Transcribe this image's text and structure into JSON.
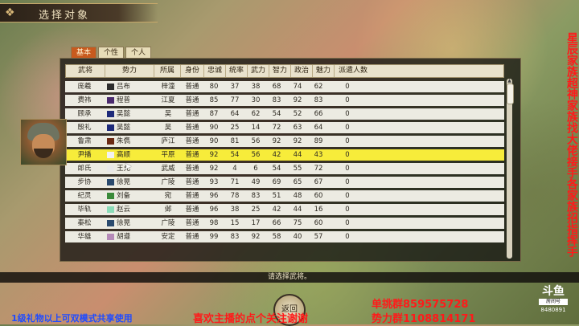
{
  "header": {
    "title": "选择对象"
  },
  "tabs": [
    "基本",
    "个性",
    "个人"
  ],
  "table": {
    "headers": [
      "武将",
      "势力",
      "所属",
      "身份",
      "忠诚",
      "统率",
      "武力",
      "智力",
      "政治",
      "魅力",
      "派遣人数"
    ],
    "rows": [
      {
        "name": "庞羲",
        "force": "吕布",
        "color": "#2c2c2c",
        "belong": "梓潼",
        "status": "普通",
        "loyalty": "80",
        "lead": "37",
        "war": "38",
        "intel": "68",
        "pol": "74",
        "chr": "62",
        "dispatch": "0",
        "selected": false
      },
      {
        "name": "费祎",
        "force": "程普",
        "color": "#4a2a6e",
        "belong": "江夏",
        "status": "普通",
        "loyalty": "85",
        "lead": "77",
        "war": "30",
        "intel": "83",
        "pol": "92",
        "chr": "83",
        "dispatch": "0",
        "selected": false
      },
      {
        "name": "顾承",
        "force": "吴懿",
        "color": "#1d2a7a",
        "belong": "吴",
        "status": "普通",
        "loyalty": "87",
        "lead": "64",
        "war": "62",
        "intel": "54",
        "pol": "52",
        "chr": "66",
        "dispatch": "0",
        "selected": false
      },
      {
        "name": "殷礼",
        "force": "吴懿",
        "color": "#1d2a7a",
        "belong": "吴",
        "status": "普通",
        "loyalty": "90",
        "lead": "25",
        "war": "14",
        "intel": "72",
        "pol": "63",
        "chr": "64",
        "dispatch": "0",
        "selected": false
      },
      {
        "name": "鲁肃",
        "force": "朱儁",
        "color": "#6b2a14",
        "belong": "庐江",
        "status": "普通",
        "loyalty": "90",
        "lead": "81",
        "war": "56",
        "intel": "92",
        "pol": "92",
        "chr": "89",
        "dispatch": "0",
        "selected": false
      },
      {
        "name": "尹播",
        "force": "高顺",
        "color": "#f2f2f2",
        "belong": "平原",
        "status": "普通",
        "loyalty": "92",
        "lead": "54",
        "war": "56",
        "intel": "42",
        "pol": "44",
        "chr": "43",
        "dispatch": "0",
        "selected": true
      },
      {
        "name": "郎氏",
        "force": "王允",
        "color": "#e8e8e8",
        "belong": "武威",
        "status": "普通",
        "loyalty": "92",
        "lead": "4",
        "war": "6",
        "intel": "54",
        "pol": "55",
        "chr": "72",
        "dispatch": "0",
        "selected": false
      },
      {
        "name": "步协",
        "force": "徐晃",
        "color": "#2a4a6e",
        "belong": "广陵",
        "status": "普通",
        "loyalty": "93",
        "lead": "71",
        "war": "49",
        "intel": "69",
        "pol": "65",
        "chr": "67",
        "dispatch": "0",
        "selected": false
      },
      {
        "name": "纪灵",
        "force": "刘备",
        "color": "#3a8a3a",
        "belong": "宛",
        "status": "普通",
        "loyalty": "96",
        "lead": "78",
        "war": "83",
        "intel": "51",
        "pol": "48",
        "chr": "60",
        "dispatch": "0",
        "selected": false
      },
      {
        "name": "毕轨",
        "force": "赵云",
        "color": "#8adcb8",
        "belong": "邺",
        "status": "普通",
        "loyalty": "96",
        "lead": "38",
        "war": "25",
        "intel": "42",
        "pol": "44",
        "chr": "16",
        "dispatch": "0",
        "selected": false
      },
      {
        "name": "秦松",
        "force": "徐晃",
        "color": "#2a4a6e",
        "belong": "广陵",
        "status": "普通",
        "loyalty": "98",
        "lead": "15",
        "war": "17",
        "intel": "66",
        "pol": "75",
        "chr": "60",
        "dispatch": "0",
        "selected": false
      },
      {
        "name": "华雄",
        "force": "胡遵",
        "color": "#b58ab8",
        "belong": "安定",
        "status": "普通",
        "loyalty": "99",
        "lead": "83",
        "war": "92",
        "intel": "58",
        "pol": "40",
        "chr": "57",
        "dispatch": "0",
        "selected": false
      }
    ]
  },
  "prompt": "请选择武将。",
  "back_button": "返回",
  "overlays": {
    "left_text": "1级礼物以上可双模式共享使用",
    "center_text": "喜欢主播的点个关注谢谢",
    "right_line1": "单挑群859575728",
    "right_line2": "势力群1108814171",
    "vertical_text": "星辰家族超神家族找大佬接手各家族招指挥手"
  },
  "logo": {
    "mark": "斗鱼",
    "sub": "房间号",
    "room": "8480891"
  }
}
